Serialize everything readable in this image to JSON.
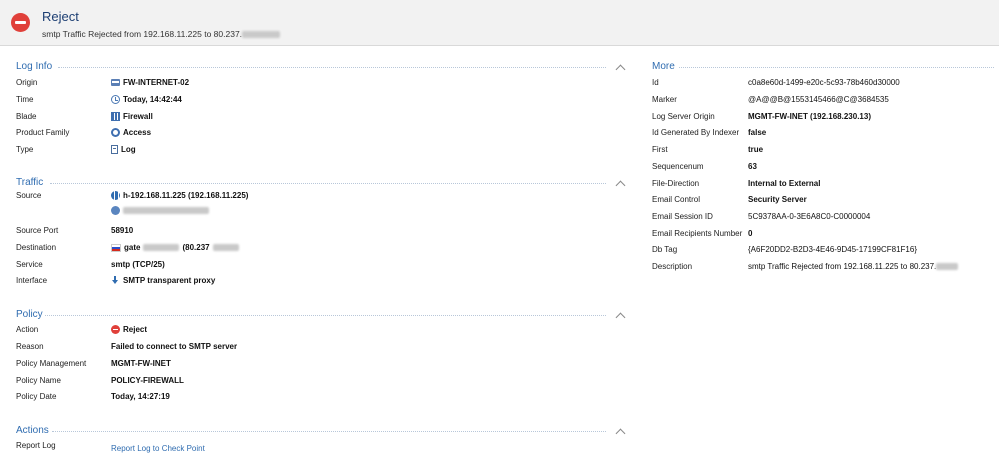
{
  "header": {
    "title": "Reject",
    "subtitle": "smtp Traffic Rejected from 192.168.11.225 to 80.237."
  },
  "log_info": {
    "title": "Log Info",
    "rows": [
      {
        "label": "Origin",
        "value": "FW-INTERNET-02",
        "icon": "gateway-icon"
      },
      {
        "label": "Time",
        "value": "Today, 14:42:44",
        "icon": "clock-icon"
      },
      {
        "label": "Blade",
        "value": "Firewall",
        "icon": "firewall-icon"
      },
      {
        "label": "Product Family",
        "value": "Access",
        "icon": "access-icon"
      },
      {
        "label": "Type",
        "value": "Log",
        "icon": "log-icon"
      }
    ]
  },
  "traffic": {
    "title": "Traffic",
    "source_label": "Source",
    "source_value": "h-192.168.11.225 (192.168.11.225)",
    "source_port_label": "Source Port",
    "source_port_value": "58910",
    "destination_label": "Destination",
    "destination_prefix": "gate",
    "destination_mid": "(80.237",
    "service_label": "Service",
    "service_value": "smtp (TCP/25)",
    "interface_label": "Interface",
    "interface_value": "SMTP transparent proxy"
  },
  "policy": {
    "title": "Policy",
    "action_label": "Action",
    "action_value": "Reject",
    "reason_label": "Reason",
    "reason_value": "Failed to connect to SMTP server",
    "management_label": "Policy Management",
    "management_value": "MGMT-FW-INET",
    "name_label": "Policy Name",
    "name_value": "POLICY-FIREWALL",
    "date_label": "Policy Date",
    "date_value": "Today, 14:27:19"
  },
  "actions": {
    "title": "Actions",
    "report_label": "Report Log",
    "report_link": "Report Log to Check Point"
  },
  "more": {
    "title": "More",
    "rows": [
      {
        "label": "Id",
        "value": "c0a8e60d-1499-e20c-5c93-78b460d30000"
      },
      {
        "label": "Marker",
        "value": "@A@@B@1553145466@C@3684535"
      },
      {
        "label": "Log Server Origin",
        "value": "MGMT-FW-INET (192.168.230.13)"
      },
      {
        "label": "Id Generated By Indexer",
        "value": "false"
      },
      {
        "label": "First",
        "value": "true"
      },
      {
        "label": "Sequencenum",
        "value": "63"
      },
      {
        "label": "File-Direction",
        "value": "Internal to External"
      },
      {
        "label": "Email Control",
        "value": "Security Server"
      },
      {
        "label": "Email Session ID",
        "value": "5C9378AA-0-3E6A8C0-C0000004"
      },
      {
        "label": "Email Recipients Number",
        "value": "0"
      },
      {
        "label": "Db Tag",
        "value": "{A6F20DD2-B2D3-4E46-9D45-17199CF81F16}"
      },
      {
        "label": "Description",
        "value": "smtp Traffic Rejected from 192.168.11.225 to 80.237."
      }
    ]
  }
}
